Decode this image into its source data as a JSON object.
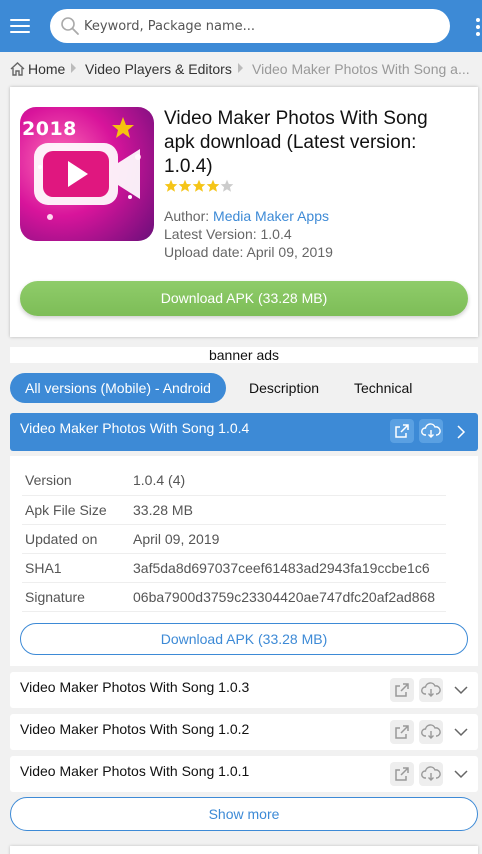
{
  "search": {
    "placeholder": "Keyword, Package name..."
  },
  "breadcrumb": {
    "home": "Home",
    "category": "Video Players & Editors",
    "current": "Video Maker Photos With Song a..."
  },
  "app": {
    "icon_badge": "2018",
    "title_line1": "Video Maker Photos With Song",
    "title_line2": "apk download (Latest version:",
    "title_line3": "1.0.4)",
    "rating_stars": 4,
    "rating_max": 5,
    "author_label": "Author: ",
    "author_name": "Media Maker Apps",
    "latest_version": "Latest Version: 1.0.4",
    "upload_date": "Upload date: April 09, 2019",
    "download_label": "Download APK (33.28 MB)"
  },
  "banner": "banner ads",
  "tabs": [
    {
      "label": "All versions (Mobile) - Android",
      "active": true
    },
    {
      "label": "Description",
      "active": false
    },
    {
      "label": "Technical",
      "active": false
    }
  ],
  "current_version": {
    "name": "Video Maker Photos With Song 1.0.4",
    "specs": [
      {
        "key": "Version",
        "value": "1.0.4 (4)"
      },
      {
        "key": "Apk File Size",
        "value": "33.28 MB"
      },
      {
        "key": "Updated on",
        "value": "April 09, 2019"
      },
      {
        "key": "SHA1",
        "value": "3af5da8d697037ceef61483ad2943fa19ccbe1c6"
      },
      {
        "key": "Signature",
        "value": "06ba7900d3759c23304420ae747dfc20af2ad868"
      }
    ],
    "download_label": "Download APK (33.28 MB)"
  },
  "other_versions": [
    {
      "name": "Video Maker Photos With Song 1.0.3"
    },
    {
      "name": "Video Maker Photos With Song 1.0.2"
    },
    {
      "name": "Video Maker Photos With Song 1.0.1"
    }
  ],
  "show_more": "Show more",
  "colors": {
    "accent": "#3d8ad6",
    "download_green": "#86c561",
    "star": "#f5c518"
  }
}
